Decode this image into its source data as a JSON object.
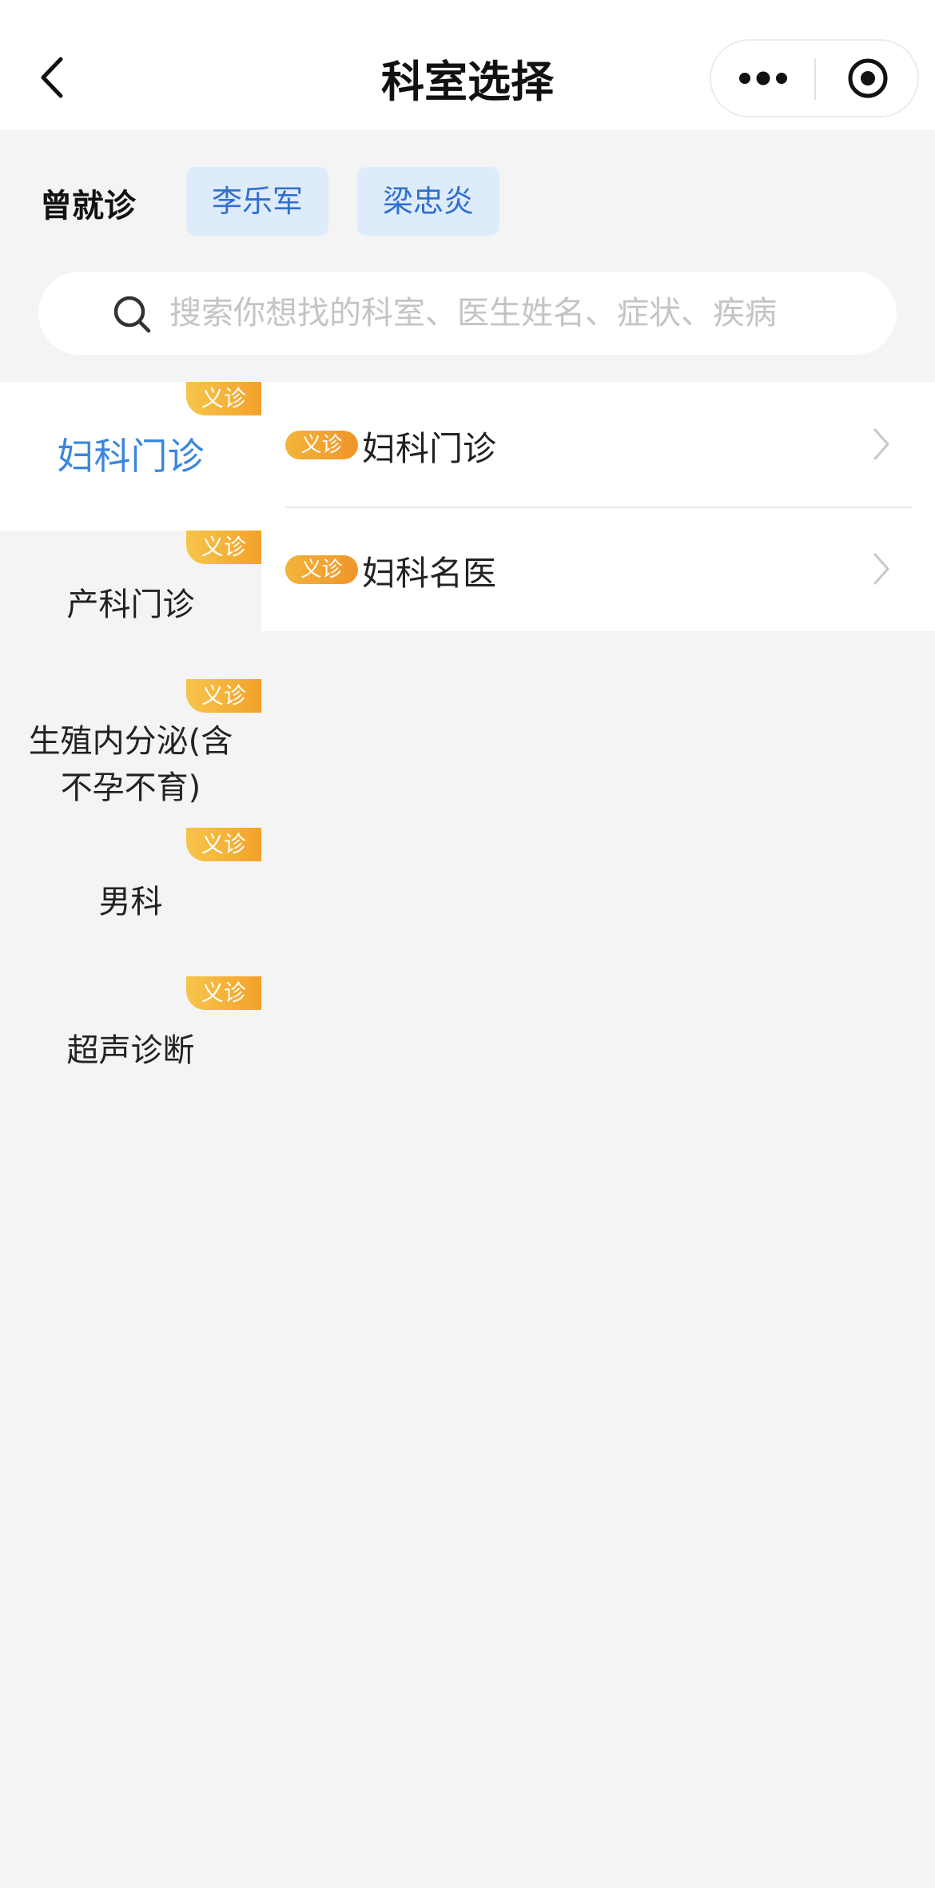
{
  "header": {
    "title": "科室选择"
  },
  "history": {
    "label": "曾就诊",
    "doctors": [
      "李乐军",
      "梁忠炎"
    ]
  },
  "search": {
    "placeholder": "搜索你想找的科室、医生姓名、症状、疾病"
  },
  "departments": [
    {
      "name": "妇科门诊",
      "badge": "义诊",
      "active": true
    },
    {
      "name": "产科门诊",
      "badge": "义诊"
    },
    {
      "name": "生殖内分泌(含不孕不育)",
      "badge": "义诊"
    },
    {
      "name": "男科",
      "badge": "义诊"
    },
    {
      "name": "超声诊断",
      "badge": "义诊"
    }
  ],
  "subdepartments": [
    {
      "tag": "义诊",
      "name": "妇科门诊"
    },
    {
      "tag": "义诊",
      "name": "妇科名医"
    }
  ],
  "colors": {
    "accent": "#3b86e0",
    "badge": "#f3a12a",
    "chip_bg": "#deebfb"
  }
}
